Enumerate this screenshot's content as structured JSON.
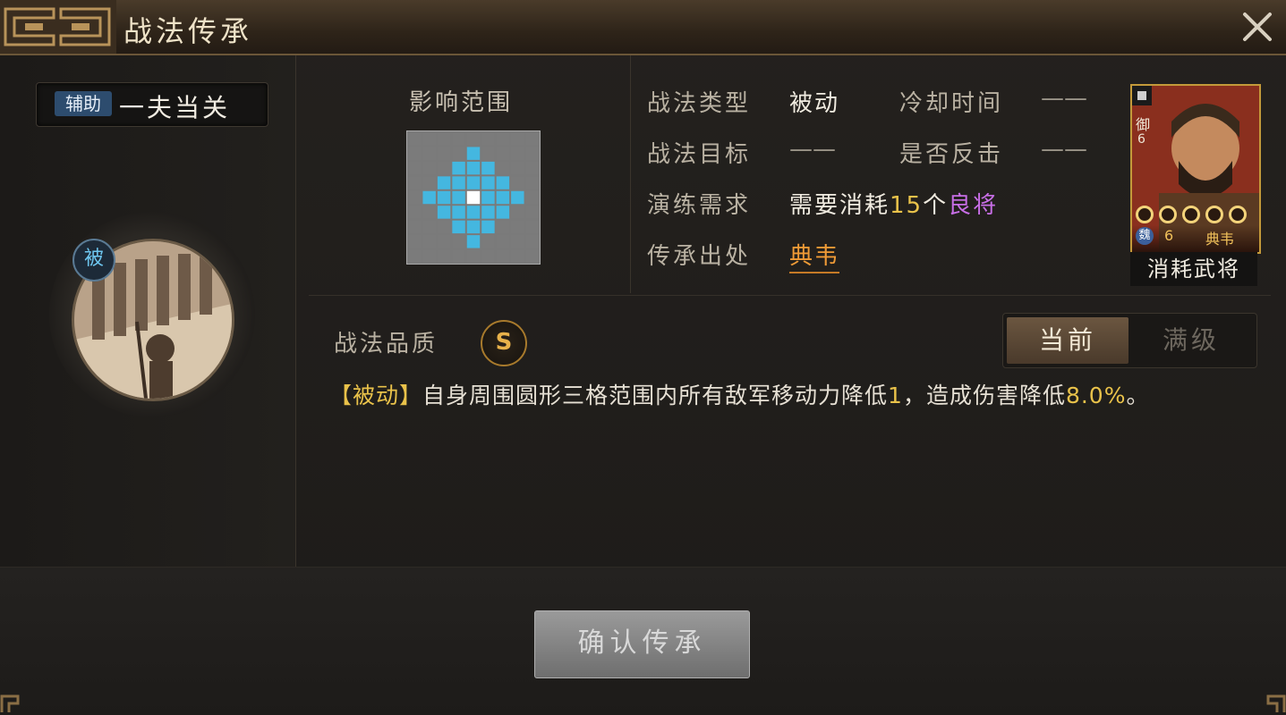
{
  "window": {
    "title": "战法传承"
  },
  "skill": {
    "category_tag": "辅助",
    "name": "一夫当关",
    "type_badge": "被"
  },
  "range": {
    "title": "影响范围",
    "rows": 9,
    "cols": 9,
    "center": [
      4,
      4
    ],
    "radius": 3
  },
  "info": {
    "type_label": "战法类型",
    "type_value": "被动",
    "cooldown_label": "冷却时间",
    "cooldown_value": "——",
    "target_label": "战法目标",
    "target_value": "——",
    "counter_label": "是否反击",
    "counter_value": "——",
    "req_label": "演练需求",
    "req_prefix": "需要消耗",
    "req_count": "15",
    "req_unit": "个",
    "req_item": "良将",
    "origin_label": "传承出处",
    "origin_value": "典韦"
  },
  "general_card": {
    "troop": "御",
    "cost": "6",
    "stars": 5,
    "faction": "魏",
    "faction_cost": "6",
    "name": "典韦",
    "caption": "消耗武将"
  },
  "quality": {
    "label": "战法品质",
    "grade": "S"
  },
  "level_toggle": {
    "current": "当前",
    "max": "满级"
  },
  "description": {
    "tag": "【被动】",
    "text_a": "自身周围圆形三格范围内所有敌军移动力降低",
    "num_a": "1",
    "text_b": "，造成伤害降低",
    "num_b": "8.0%",
    "text_c": "。"
  },
  "actions": {
    "confirm": "确认传承"
  },
  "colors": {
    "accent_gold": "#e9c24a",
    "range_cell": "#44b7e0",
    "quality_purple": "#c86ee6",
    "origin_orange": "#ef9a36"
  }
}
